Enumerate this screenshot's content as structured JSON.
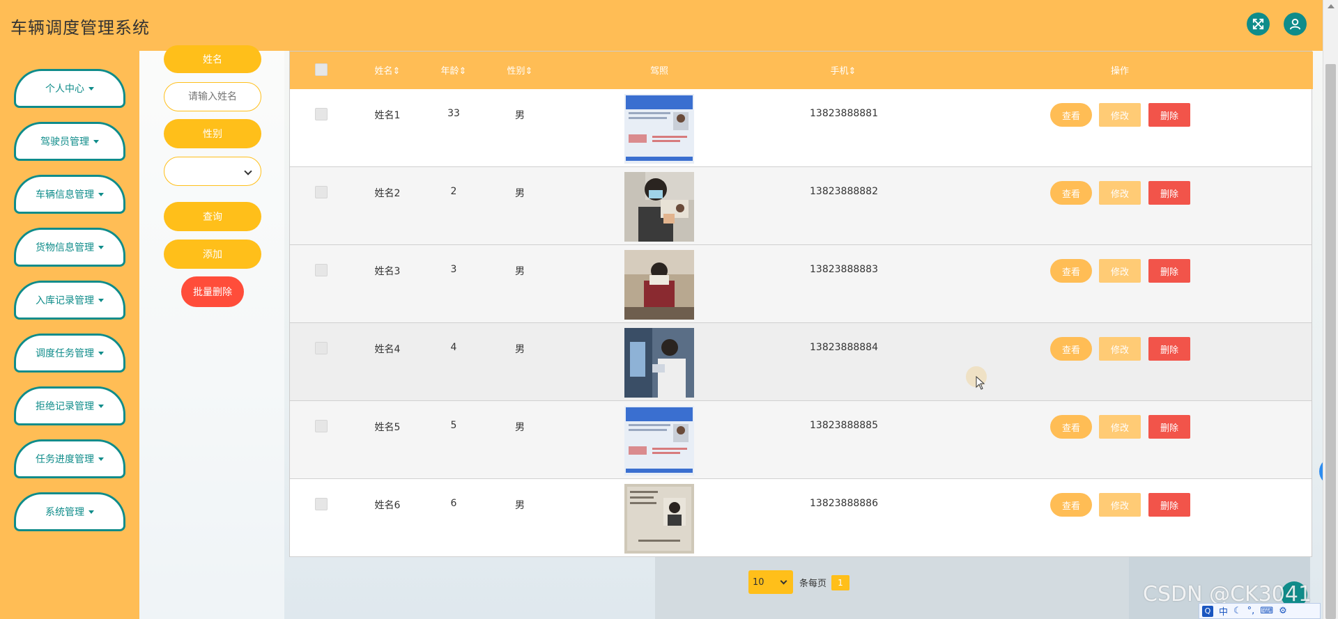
{
  "header": {
    "title": "车辆调度管理系统"
  },
  "sidebar": {
    "items": [
      {
        "label": "个人中心"
      },
      {
        "label": "驾驶员管理"
      },
      {
        "label": "车辆信息管理"
      },
      {
        "label": "货物信息管理"
      },
      {
        "label": "入库记录管理"
      },
      {
        "label": "调度任务管理"
      },
      {
        "label": "拒绝记录管理"
      },
      {
        "label": "任务进度管理"
      },
      {
        "label": "系统管理"
      }
    ]
  },
  "search": {
    "name_label": "姓名",
    "name_placeholder": "请输入姓名",
    "gender_label": "性别",
    "gender_value": "",
    "query_button": "查询",
    "add_button": "添加",
    "batch_delete_button": "批量删除"
  },
  "table": {
    "columns": [
      "姓名⇕",
      "年龄⇕",
      "性别⇕",
      "驾照",
      "手机⇕",
      "操作"
    ],
    "rows": [
      {
        "name": "姓名1",
        "age": "33",
        "gender": "男",
        "phone": "13823888881"
      },
      {
        "name": "姓名2",
        "age": "2",
        "gender": "男",
        "phone": "13823888882"
      },
      {
        "name": "姓名3",
        "age": "3",
        "gender": "男",
        "phone": "13823888883"
      },
      {
        "name": "姓名4",
        "age": "4",
        "gender": "男",
        "phone": "13823888884"
      },
      {
        "name": "姓名5",
        "age": "5",
        "gender": "男",
        "phone": "13823888885"
      },
      {
        "name": "姓名6",
        "age": "6",
        "gender": "男",
        "phone": "13823888886"
      }
    ],
    "actions": {
      "view": "查看",
      "edit": "修改",
      "delete": "删除"
    }
  },
  "pagination": {
    "page_size": "10",
    "per_page_label": "条每页",
    "current_page": "1"
  },
  "overlay": {
    "watermark": "CSDN @CK3041",
    "ime_q": "Q",
    "ime_lang": "中"
  },
  "colors": {
    "primary": "#ffbd55",
    "accent": "#0f8c8a",
    "gold": "#ffbf1a",
    "danger": "#f2544a"
  },
  "icons": [
    "fullscreen-icon",
    "user-icon",
    "collapse-icon"
  ]
}
